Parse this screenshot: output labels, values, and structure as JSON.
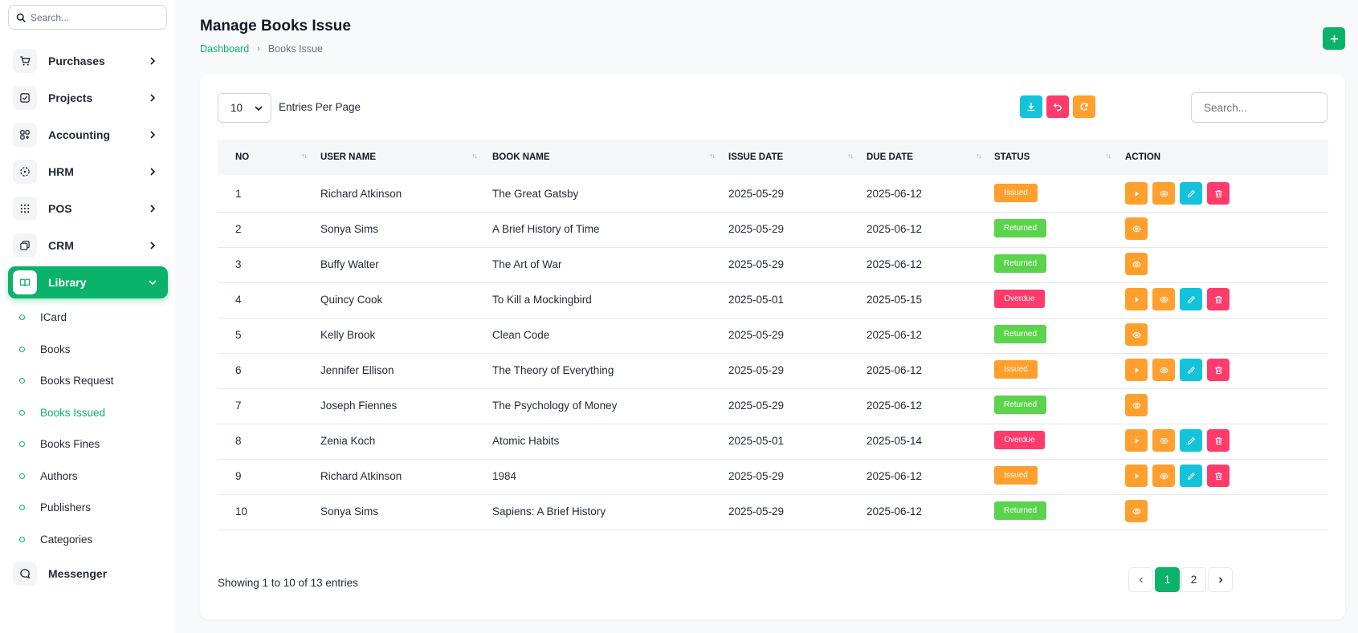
{
  "sidebar": {
    "search_placeholder": "Search...",
    "items": [
      {
        "label": "Purchases",
        "icon": "cart-icon"
      },
      {
        "label": "Projects",
        "icon": "checkbox-icon"
      },
      {
        "label": "Accounting",
        "icon": "grid-plus-icon"
      },
      {
        "label": "HRM",
        "icon": "dashed-circle-icon"
      },
      {
        "label": "POS",
        "icon": "dots-grid-icon"
      },
      {
        "label": "CRM",
        "icon": "copy-icon"
      },
      {
        "label": "Library",
        "icon": "book-open-icon",
        "active": true
      },
      {
        "label": "Messenger",
        "icon": "chat-icon"
      }
    ],
    "library_sub": [
      {
        "label": "ICard"
      },
      {
        "label": "Books"
      },
      {
        "label": "Books Request"
      },
      {
        "label": "Books Issued",
        "active": true
      },
      {
        "label": "Books Fines"
      },
      {
        "label": "Authors"
      },
      {
        "label": "Publishers"
      },
      {
        "label": "Categories"
      }
    ]
  },
  "header": {
    "title": "Manage Books Issue",
    "breadcrumb": {
      "home": "Dashboard",
      "current": "Books Issue"
    },
    "add_label": "+"
  },
  "toolbar": {
    "entries_value": "10",
    "entries_label": "Entries Per Page",
    "search_placeholder": "Search..."
  },
  "table": {
    "columns": [
      "NO",
      "USER NAME",
      "BOOK NAME",
      "ISSUE DATE",
      "DUE DATE",
      "STATUS",
      "ACTION"
    ],
    "rows": [
      {
        "no": "1",
        "user": "Richard Atkinson",
        "book": "The Great Gatsby",
        "issue": "2025-05-29",
        "due": "2025-06-12",
        "status": "Issued"
      },
      {
        "no": "2",
        "user": "Sonya Sims",
        "book": "A Brief History of Time",
        "issue": "2025-05-29",
        "due": "2025-06-12",
        "status": "Returned"
      },
      {
        "no": "3",
        "user": "Buffy Walter",
        "book": "The Art of War",
        "issue": "2025-05-29",
        "due": "2025-06-12",
        "status": "Returned"
      },
      {
        "no": "4",
        "user": "Quincy Cook",
        "book": "To Kill a Mockingbird",
        "issue": "2025-05-01",
        "due": "2025-05-15",
        "status": "Overdue"
      },
      {
        "no": "5",
        "user": "Kelly Brook",
        "book": "Clean Code",
        "issue": "2025-05-29",
        "due": "2025-06-12",
        "status": "Returned"
      },
      {
        "no": "6",
        "user": "Jennifer Ellison",
        "book": "The Theory of Everything",
        "issue": "2025-05-29",
        "due": "2025-06-12",
        "status": "Issued"
      },
      {
        "no": "7",
        "user": "Joseph Fiennes",
        "book": "The Psychology of Money",
        "issue": "2025-05-29",
        "due": "2025-06-12",
        "status": "Returned"
      },
      {
        "no": "8",
        "user": "Zenia Koch",
        "book": "Atomic Habits",
        "issue": "2025-05-01",
        "due": "2025-05-14",
        "status": "Overdue"
      },
      {
        "no": "9",
        "user": "Richard Atkinson",
        "book": "1984",
        "issue": "2025-05-29",
        "due": "2025-06-12",
        "status": "Issued"
      },
      {
        "no": "10",
        "user": "Sonya Sims",
        "book": "Sapiens: A Brief History",
        "issue": "2025-05-29",
        "due": "2025-06-12",
        "status": "Returned"
      }
    ]
  },
  "footer": {
    "showing": "Showing 1 to 10 of 13 entries",
    "pages": [
      "1",
      "2"
    ],
    "current_page": "1"
  },
  "colors": {
    "brand": "#0ab26a",
    "issued": "#ff9f2e",
    "returned": "#5bd34c",
    "overdue": "#ff3b6b",
    "action_return": "#ff9f2e",
    "action_view": "#ff9f2e",
    "action_edit": "#12c3d9",
    "action_delete": "#ff3b6b",
    "tool_export": "#12c3d9",
    "tool_reset": "#ff3b6b",
    "tool_refresh": "#ff9f2e"
  }
}
